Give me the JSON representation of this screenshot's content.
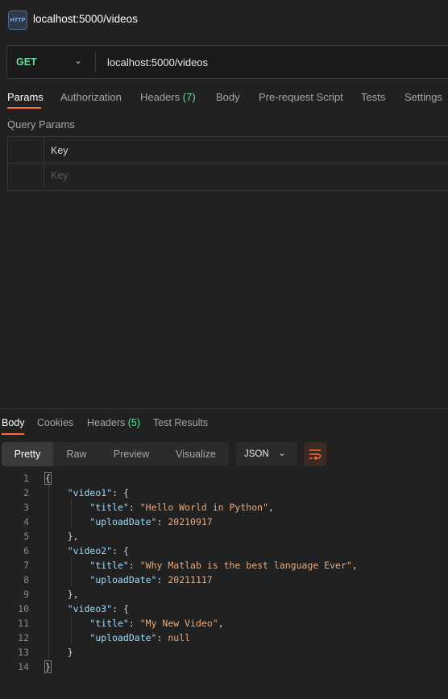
{
  "tab": {
    "icon": "HTTP",
    "title": "localhost:5000/videos"
  },
  "request": {
    "method": "GET",
    "url": "localhost:5000/videos",
    "tabs": [
      {
        "label": "Params"
      },
      {
        "label": "Authorization"
      },
      {
        "label": "Headers",
        "count": "(7)"
      },
      {
        "label": "Body"
      },
      {
        "label": "Pre-request Script"
      },
      {
        "label": "Tests"
      },
      {
        "label": "Settings"
      }
    ],
    "query_params_label": "Query Params",
    "table": {
      "key_header": "Key",
      "key_placeholder": "Key"
    }
  },
  "response": {
    "tabs": [
      {
        "label": "Body"
      },
      {
        "label": "Cookies"
      },
      {
        "label": "Headers",
        "count": "(5)"
      },
      {
        "label": "Test Results"
      }
    ],
    "view_modes": [
      "Pretty",
      "Raw",
      "Preview",
      "Visualize"
    ],
    "format": "JSON",
    "line_numbers": [
      "1",
      "2",
      "3",
      "4",
      "5",
      "6",
      "7",
      "8",
      "9",
      "10",
      "11",
      "12",
      "13",
      "14"
    ],
    "body": {
      "video1": {
        "title": "Hello World in Python",
        "uploadDate": "20210917"
      },
      "video2": {
        "title": "Why Matlab is the best language Ever",
        "uploadDate": "20211117"
      },
      "video3": {
        "title": "My New Video",
        "uploadDate": "null"
      }
    }
  },
  "colors": {
    "accent": "#ff6c37",
    "method": "#6bdd9a",
    "json_key": "#9cdcfe",
    "json_value": "#e8a97c"
  }
}
